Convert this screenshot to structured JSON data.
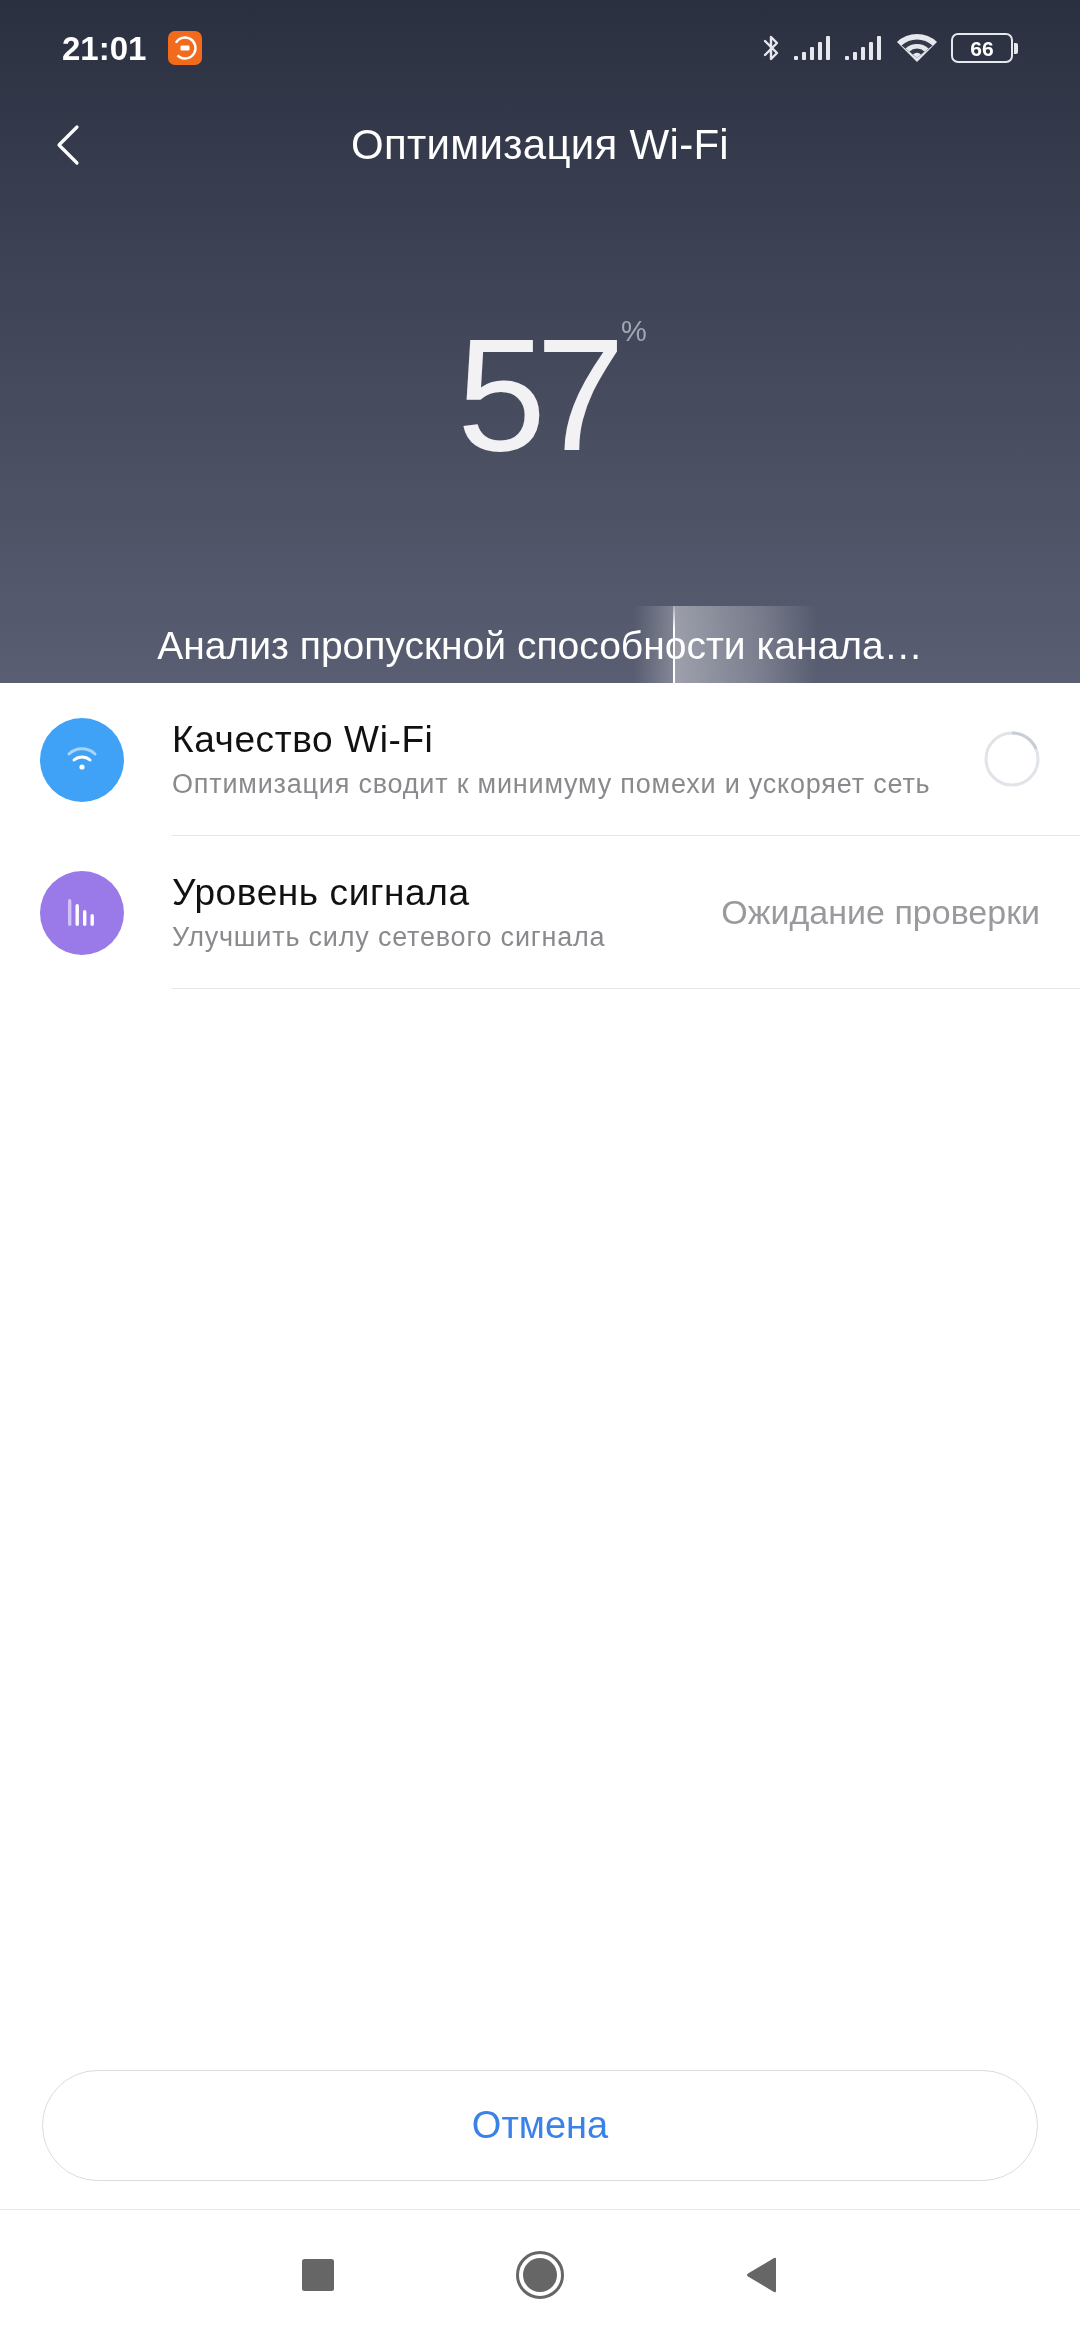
{
  "status_bar": {
    "time": "21:01",
    "battery": "66"
  },
  "app_bar": {
    "title": "Оптимизация Wi-Fi"
  },
  "progress": {
    "value": "57",
    "unit": "%",
    "status": "Анализ пропускной способности канала…"
  },
  "checks": [
    {
      "kind": "wifi_quality",
      "title": "Качество Wi-Fi",
      "subtitle": "Оптимизация сводит к минимуму помехи и ускоряет сеть",
      "color": "#3fa2f6",
      "status": {
        "kind": "spinner"
      }
    },
    {
      "kind": "signal_level",
      "title": "Уровень сигнала",
      "subtitle": "Улучшить силу сетевого сигнала",
      "color": "#9a7ae9",
      "status": {
        "kind": "text",
        "text": "Ожидание проверки"
      }
    }
  ],
  "buttons": [
    {
      "label": "Отмена"
    }
  ]
}
